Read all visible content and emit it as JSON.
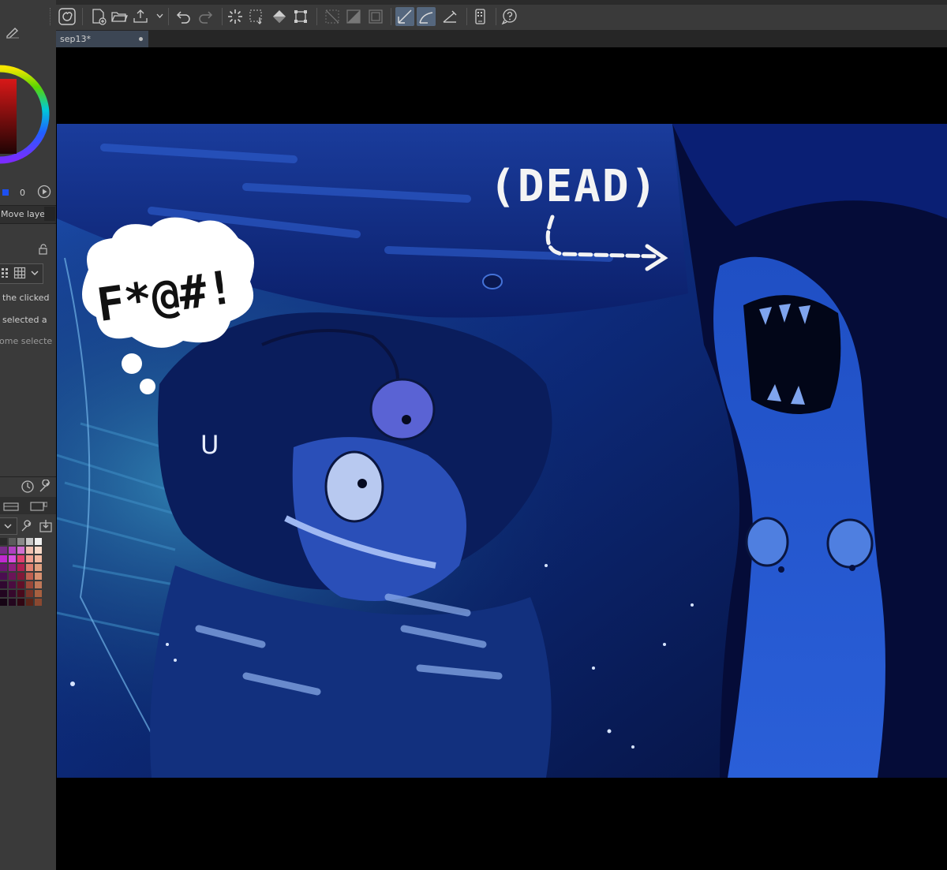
{
  "document": {
    "tab_title": "sep13*"
  },
  "color_panel": {
    "value_readout": "0",
    "accent": "#1d4ff0"
  },
  "tool_property": {
    "label": "Move layer"
  },
  "layer_options": {
    "line1": "the clicked",
    "line2": "selected a",
    "line3": "ome selecte"
  },
  "artwork": {
    "speech_bubble_text": "F*@#!",
    "dead_label": "(DEAD)",
    "sweat_mark": "U"
  },
  "toolbar": {
    "icons": [
      "app-menu-icon",
      "new-canvas-icon",
      "open-folder-icon",
      "export-icon",
      "undo-icon",
      "redo-icon",
      "deselect-icon",
      "show-selection-icon",
      "fill-icon",
      "transform-icon",
      "ruler-snap-icon",
      "ruler-icon",
      "perspective-icon",
      "snap-ruler-icon",
      "snap-special-icon",
      "snap-grid-icon",
      "smartphone-icon",
      "help-icon"
    ]
  },
  "colors": {
    "panel_bg": "#3a3a3a",
    "tab_bg": "#3c4654",
    "active_button": "#55677e"
  }
}
